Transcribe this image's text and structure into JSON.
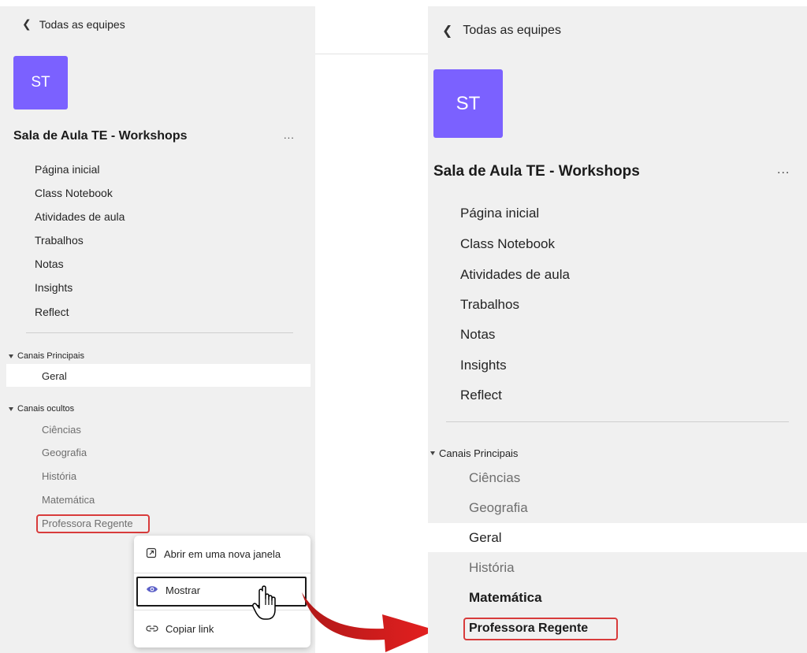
{
  "left": {
    "back_label": "Todas as equipes",
    "avatar_initials": "ST",
    "team_name": "Sala de Aula TE - Workshops",
    "more_label": "...",
    "nav": [
      "Página inicial",
      "Class Notebook",
      "Atividades de aula",
      "Trabalhos",
      "Notas",
      "Insights",
      "Reflect"
    ],
    "section_main": "Canais Principais",
    "main_channels": [
      "Geral"
    ],
    "section_hidden": "Canais ocultos",
    "hidden_channels": [
      "Ciências",
      "Geografia",
      "História",
      "Matemática",
      "Professora Regente"
    ]
  },
  "context_menu": {
    "items": [
      {
        "label": "Abrir em uma nova janela",
        "icon": "open-new-window-icon"
      },
      {
        "label": "Mostrar",
        "icon": "eye-icon"
      },
      {
        "label": "Copiar link",
        "icon": "link-icon"
      }
    ]
  },
  "right": {
    "back_label": "Todas as equipes",
    "avatar_initials": "ST",
    "team_name": "Sala de Aula TE - Workshops",
    "more_label": "...",
    "nav": [
      "Página inicial",
      "Class Notebook",
      "Atividades de aula",
      "Trabalhos",
      "Notas",
      "Insights",
      "Reflect"
    ],
    "section_main": "Canais Principais",
    "channels": [
      "Ciências",
      "Geografia",
      "Geral",
      "História",
      "Matemática",
      "Professora Regente"
    ]
  },
  "colors": {
    "avatar": "#7b61ff",
    "highlight_border": "#d83b3b",
    "arrow": "#d81f1f",
    "panel_bg": "#f0f0f0"
  }
}
